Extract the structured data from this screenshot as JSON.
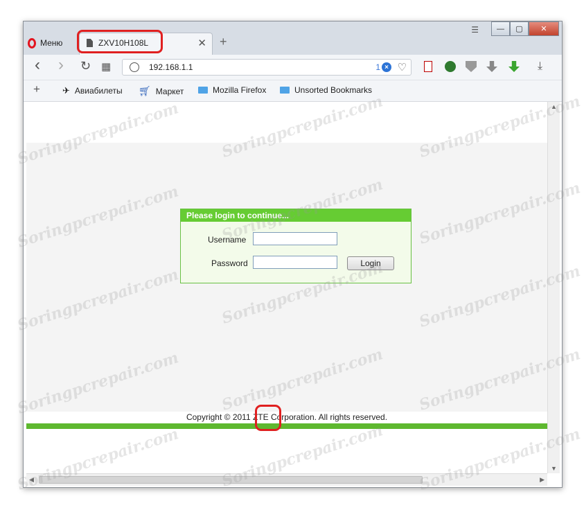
{
  "browser": {
    "menu_label": "Меню",
    "tab": {
      "title": "ZXV10H108L",
      "close": "✕"
    },
    "new_tab": "+",
    "window_controls": {
      "minimize": "—",
      "maximize": "▢",
      "close": "✕"
    },
    "nav": {
      "back": "‹",
      "forward": "›",
      "reload": "↻",
      "speed_dial": "▦"
    },
    "address": {
      "url": "192.168.1.1",
      "badge_count": "1"
    },
    "download": "⤓"
  },
  "bookmarks": {
    "add": "+",
    "items": [
      {
        "label": "Авиабилеты"
      },
      {
        "label": "Маркет"
      },
      {
        "label": "Mozilla Firefox"
      },
      {
        "label": "Unsorted Bookmarks"
      }
    ]
  },
  "page": {
    "login_header": "Please login to continue...",
    "username_label": "Username",
    "password_label": "Password",
    "login_button": "Login",
    "copyright": "Copyright © 2011 ZTE Corporation. All rights reserved."
  },
  "watermark": "Soringpcrepair.com",
  "colors": {
    "accent_green": "#66cc33",
    "highlight_red": "#e02020"
  }
}
